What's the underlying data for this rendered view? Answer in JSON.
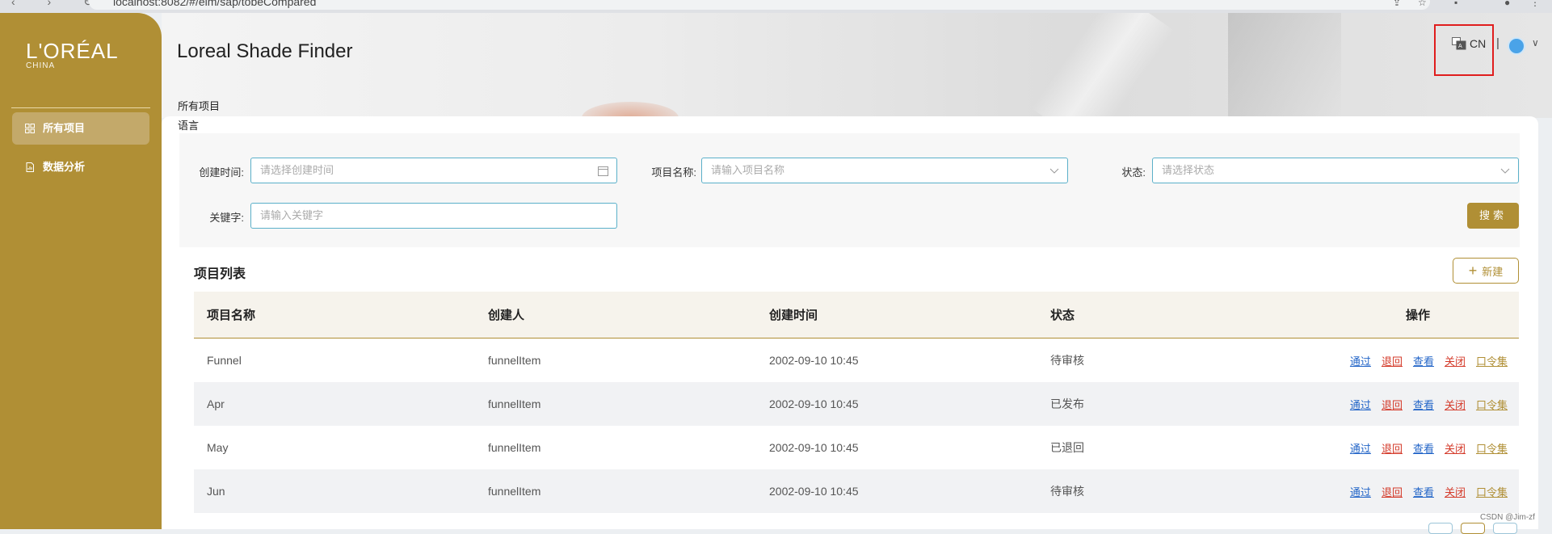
{
  "browser": {
    "url": "localhost:8082/#/elm/sap/tobeCompared"
  },
  "sidebar": {
    "logo_brand": "L'ORÉAL",
    "logo_sub": "CHINA",
    "items": [
      {
        "label": "所有项目",
        "icon": "grid-icon",
        "active": true
      },
      {
        "label": "数据分析",
        "icon": "document-chart-icon",
        "active": false
      }
    ]
  },
  "header": {
    "title": "Loreal Shade Finder",
    "lang": "CN",
    "separator": "|",
    "caret": "∨"
  },
  "breadcrumb": "所有项目",
  "language_label": "语言",
  "filters": {
    "created_time": {
      "label": "创建时间:",
      "placeholder": "请选择创建时间"
    },
    "project_name": {
      "label": "项目名称:",
      "placeholder": "请输入项目名称"
    },
    "status": {
      "label": "状态:",
      "placeholder": "请选择状态"
    },
    "keyword": {
      "label": "关键字:",
      "placeholder": "请输入关键字"
    },
    "search_button": "搜索"
  },
  "list": {
    "title": "项目列表",
    "new_button": "新建",
    "columns": [
      "项目名称",
      "创建人",
      "创建时间",
      "状态",
      "操作"
    ],
    "rows": [
      {
        "name": "Funnel",
        "creator": "funnelItem",
        "time": "2002-09-10 10:45",
        "status": "待审核"
      },
      {
        "name": "Apr",
        "creator": "funnelItem",
        "time": "2002-09-10 10:45",
        "status": "已发布"
      },
      {
        "name": "May",
        "creator": "funnelItem",
        "time": "2002-09-10 10:45",
        "status": "已退回"
      },
      {
        "name": "Jun",
        "creator": "funnelItem",
        "time": "2002-09-10 10:45",
        "status": "待审核"
      }
    ],
    "actions": [
      "通过",
      "退回",
      "查看",
      "关闭",
      "口令集"
    ]
  },
  "watermark": "CSDN @Jim-zf",
  "colors": {
    "brand_gold": "#b08f35",
    "link_blue": "#2466c8",
    "link_red": "#d43a2a",
    "highlight_red": "#e01e1e"
  }
}
